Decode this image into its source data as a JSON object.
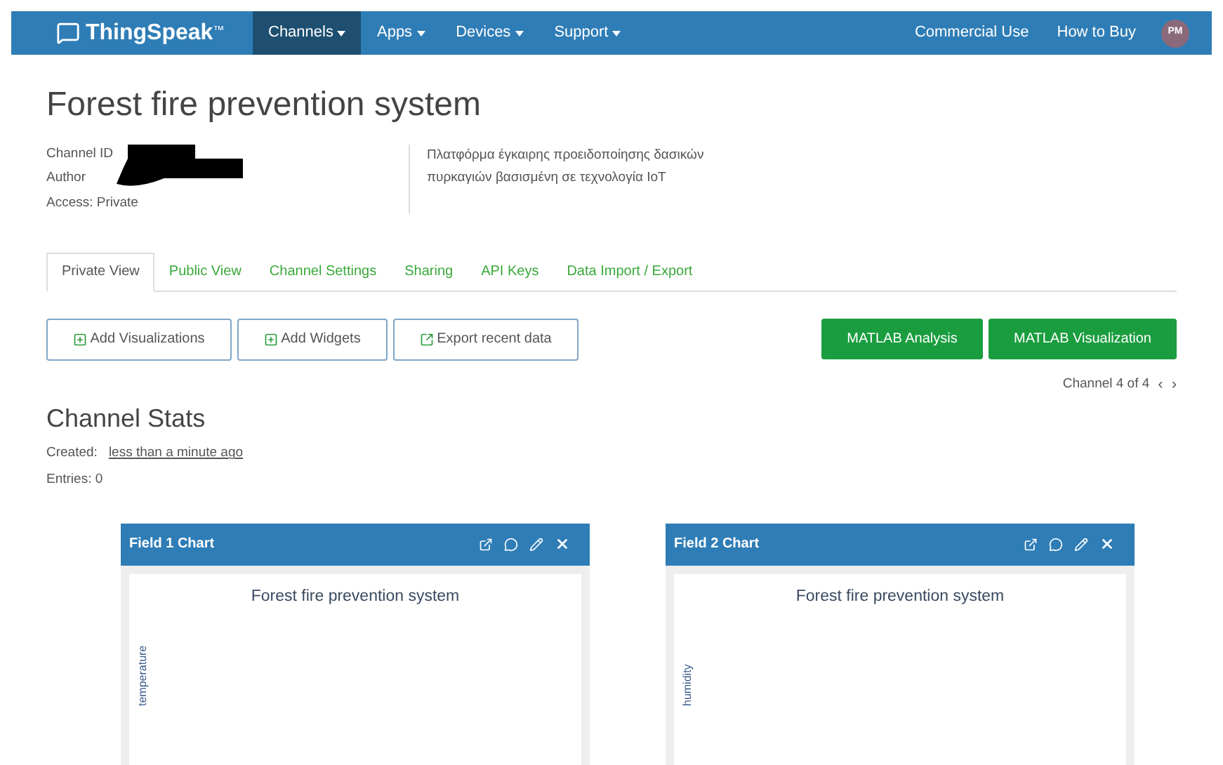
{
  "navbar": {
    "logo": "ThingSpeak",
    "trademark": "™",
    "menus": [
      {
        "label": "Channels",
        "selected": true
      },
      {
        "label": "Apps",
        "selected": false
      },
      {
        "label": "Devices",
        "selected": false
      },
      {
        "label": "Support",
        "selected": false
      }
    ],
    "right_links": [
      "Commercial Use",
      "How to Buy"
    ],
    "avatar": "PM"
  },
  "channel": {
    "title": "Forest fire prevention system",
    "info": [
      "Channel ID",
      "Author",
      "Access: Private"
    ],
    "description": "Πλατφόρμα  έγκαιρης προειδοποίησης δασικών πυρκαγιών βασισμένη σε τεχνολογία IoT"
  },
  "tabs": [
    {
      "label": "Private View",
      "selected": true
    },
    {
      "label": "Public View",
      "selected": false
    },
    {
      "label": "Channel Settings",
      "selected": false
    },
    {
      "label": "Sharing",
      "selected": false
    },
    {
      "label": "API Keys",
      "selected": false
    },
    {
      "label": "Data Import / Export",
      "selected": false
    }
  ],
  "actions": [
    {
      "label": "Add Visualizations",
      "kind": "plus"
    },
    {
      "label": "Add Widgets",
      "kind": "plus"
    },
    {
      "label": "Export recent data",
      "kind": "export"
    }
  ],
  "matlab_buttons": [
    "MATLAB Analysis",
    "MATLAB Visualization"
  ],
  "pager": {
    "label": "Channel 4 of 4",
    "prev": "‹",
    "next": "›"
  },
  "stats": {
    "heading": "Channel Stats",
    "created_label": "Created:",
    "created_value": "less than a minute ago",
    "entries": "Entries: 0"
  },
  "charts": [
    {
      "header": "Field 1 Chart",
      "title": "Forest fire prevention system",
      "ylabel": "temperature"
    },
    {
      "header": "Field 2 Chart",
      "title": "Forest fire prevention system",
      "ylabel": "humidity"
    }
  ]
}
